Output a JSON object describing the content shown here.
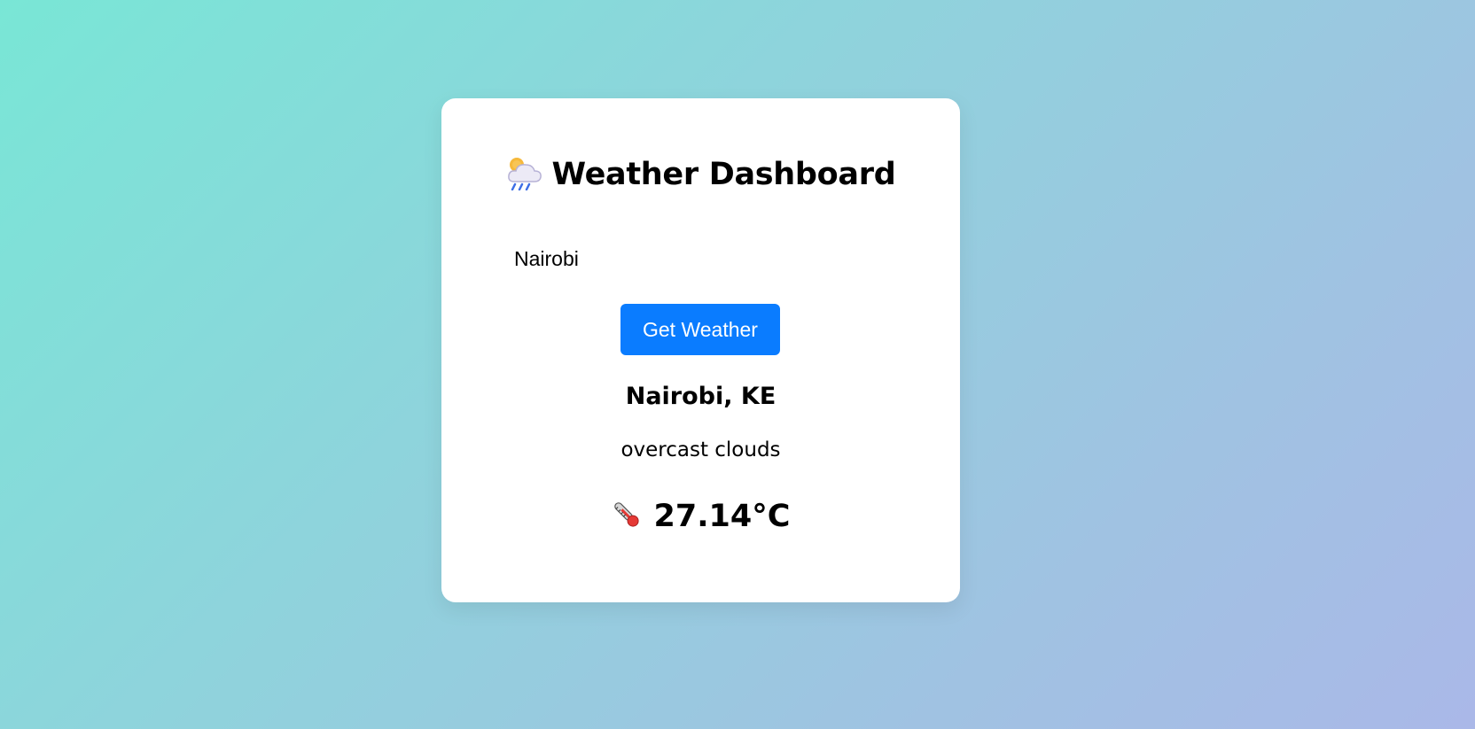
{
  "app": {
    "title": "Weather Dashboard",
    "title_icon": "cloud-sun-rain-icon"
  },
  "search": {
    "value": "Nairobi",
    "button_label": "Get Weather"
  },
  "result": {
    "location": "Nairobi, KE",
    "description": "overcast clouds",
    "temperature": "27.14°C",
    "temperature_icon": "thermometer-icon"
  },
  "colors": {
    "button": "#0a7cff",
    "card": "#ffffff",
    "gradient_start": "#79e6d6",
    "gradient_end": "#aab8e8"
  }
}
